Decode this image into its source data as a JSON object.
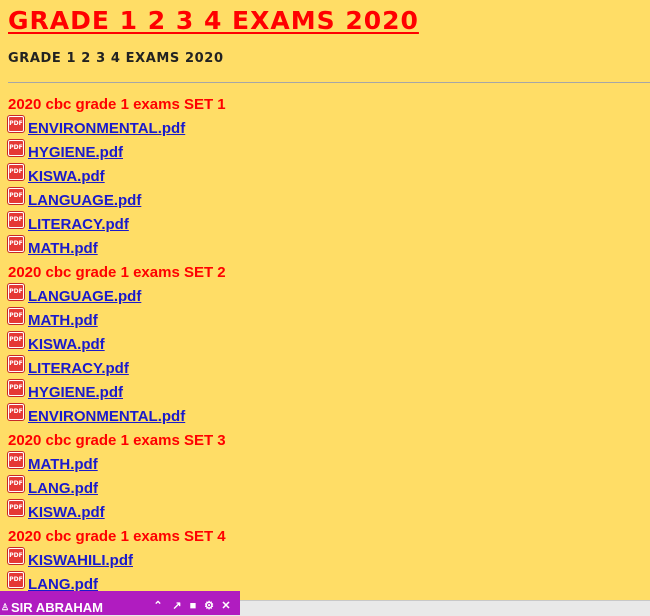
{
  "page": {
    "title": "GRADE 1 2 3 4 EXAMS 2020",
    "subtitle": "GRADE 1 2 3 4 EXAMS 2020"
  },
  "icons": {
    "file": "pdf-file-icon",
    "file_label": "PDF"
  },
  "colors": {
    "background": "#ffdd66",
    "title": "#ff0000",
    "link": "#1a1acc",
    "chat_bar": "#b01cc0"
  },
  "sections": [
    {
      "header": "2020 cbc grade 1 exams SET 1",
      "files": [
        "ENVIRONMENTAL.pdf",
        "HYGIENE.pdf",
        "KISWA.pdf",
        "LANGUAGE.pdf",
        "LITERACY.pdf",
        "MATH.pdf"
      ]
    },
    {
      "header": "2020 cbc grade 1 exams SET 2",
      "files": [
        "LANGUAGE.pdf",
        "MATH.pdf",
        "KISWA.pdf",
        "LITERACY.pdf",
        "HYGIENE.pdf",
        "ENVIRONMENTAL.pdf"
      ]
    },
    {
      "header": "2020 cbc grade 1 exams SET 3",
      "files": [
        "MATH.pdf",
        "LANG.pdf",
        "KISWA.pdf"
      ]
    },
    {
      "header": "2020 cbc grade 1 exams SET 4",
      "files": [
        "KISWAHILI.pdf",
        "LANG.pdf"
      ]
    }
  ],
  "chat": {
    "name": "SIR ABRAHAM",
    "user_icon": "user-icon",
    "controls": [
      {
        "name": "collapse-button",
        "icon": "chevron-up-icon",
        "glyph": "⌃"
      },
      {
        "name": "popout-button",
        "icon": "popout-icon",
        "glyph": "↗"
      },
      {
        "name": "video-call-button",
        "icon": "video-camera-icon",
        "glyph": "■"
      },
      {
        "name": "settings-button",
        "icon": "gear-icon",
        "glyph": "⚙"
      },
      {
        "name": "close-button",
        "icon": "close-icon",
        "glyph": "✕"
      }
    ]
  }
}
